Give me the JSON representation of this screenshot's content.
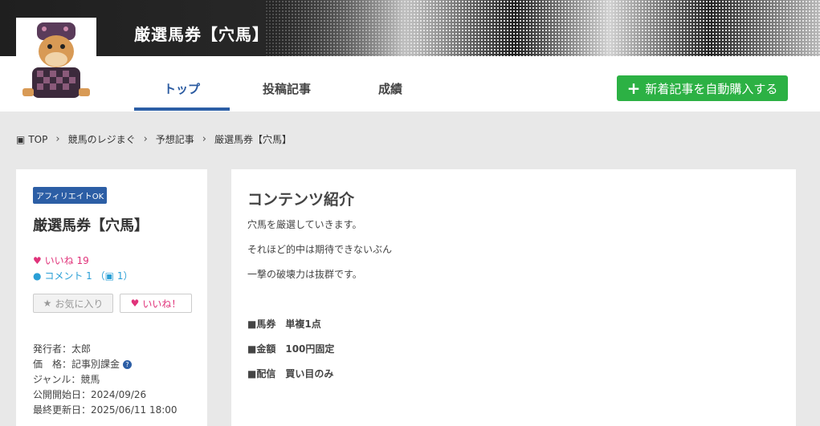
{
  "header": {
    "title": "厳選馬券【穴馬】"
  },
  "nav": {
    "tabs": [
      "トップ",
      "投稿記事",
      "成績"
    ],
    "buy_button": "新着記事を自動購入する"
  },
  "breadcrumb": [
    "TOP",
    "競馬のレジまぐ",
    "予想記事",
    "厳選馬券【穴馬】"
  ],
  "sidebar": {
    "badge": "アフィリエイトOK",
    "title": "厳選馬券【穴馬】",
    "likes_label": "いいね",
    "likes_count": "19",
    "comments_label": "コメント",
    "comments_count": "1",
    "gift_count": "1",
    "favorite_button": "お気に入り",
    "like_button": "いいね！",
    "publisher": "発行者：太郎",
    "price": "価　格：記事別課金",
    "genre": "ジャンル：競馬",
    "start_date": "公開開始日：2024/09/26",
    "updated": "最終更新日：2025/06/11 18:00"
  },
  "content": {
    "heading": "コンテンツ紹介",
    "lines": [
      "穴馬を厳選していきます。",
      "それほど的中は期待できないぶん",
      "一撃の破壊力は抜群です。"
    ],
    "bold_lines": [
      "■馬券　単複1点",
      "■金額　100円固定",
      "■配信　買い目のみ"
    ]
  },
  "colors": {
    "accent_blue": "#2c5ea5",
    "buy_green": "#2cb144",
    "like_pink": "#e0337a",
    "comment_blue": "#2a9fd6"
  }
}
